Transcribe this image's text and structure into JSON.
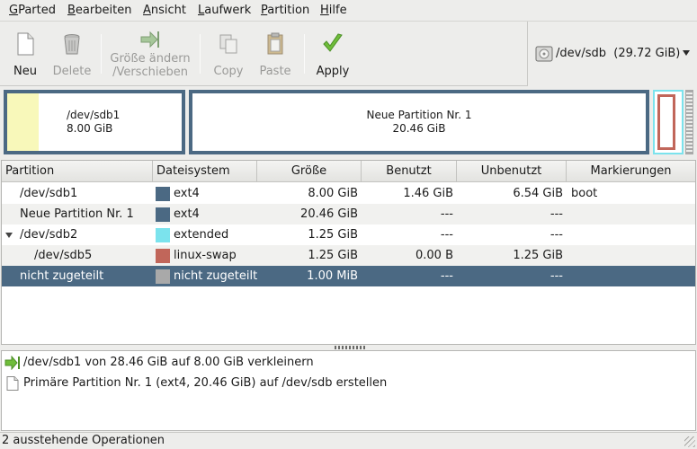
{
  "menubar": [
    {
      "pre": "",
      "key": "G",
      "post": "Parted"
    },
    {
      "pre": "",
      "key": "B",
      "post": "earbeiten"
    },
    {
      "pre": "",
      "key": "A",
      "post": "nsicht"
    },
    {
      "pre": "",
      "key": "L",
      "post": "aufwerk"
    },
    {
      "pre": "",
      "key": "P",
      "post": "artition"
    },
    {
      "pre": "",
      "key": "H",
      "post": "ilfe"
    }
  ],
  "toolbar": {
    "new": "Neu",
    "delete": "Delete",
    "resize_line1": "Größe ändern",
    "resize_line2": "/Verschieben",
    "copy": "Copy",
    "paste": "Paste",
    "apply": "Apply"
  },
  "device": {
    "name": "/dev/sdb",
    "size": "(29.72 GiB)",
    "icon": "harddisk-icon"
  },
  "graphic": {
    "sdb1_name": "/dev/sdb1",
    "sdb1_size": "8.00 GiB",
    "sdb1_used_fraction": 0.18,
    "new_name": "Neue Partition Nr. 1",
    "new_size": "20.46 GiB"
  },
  "table": {
    "headers": [
      "Partition",
      "Dateisystem",
      "Größe",
      "Benutzt",
      "Unbenutzt",
      "Markierungen"
    ],
    "rows": [
      {
        "partition": "/dev/sdb1",
        "fs": "ext4",
        "color": "#4b6983",
        "size": "8.00 GiB",
        "used": "1.46 GiB",
        "unused": "6.54 GiB",
        "flags": "boot"
      },
      {
        "partition": "Neue Partition Nr. 1",
        "fs": "ext4",
        "color": "#4b6983",
        "size": "20.46 GiB",
        "used": "---",
        "unused": "---",
        "flags": ""
      },
      {
        "partition": "/dev/sdb2",
        "fs": "extended",
        "color": "#7be3ed",
        "size": "1.25 GiB",
        "used": "---",
        "unused": "---",
        "flags": ""
      },
      {
        "partition": "/dev/sdb5",
        "fs": "linux-swap",
        "color": "#c1665a",
        "size": "1.25 GiB",
        "used": "0.00 B",
        "unused": "1.25 GiB",
        "flags": ""
      },
      {
        "partition": "nicht zugeteilt",
        "fs": "nicht zugeteilt",
        "color": "#a9a9a9",
        "size": "1.00 MiB",
        "used": "---",
        "unused": "---",
        "flags": ""
      }
    ]
  },
  "operations": [
    {
      "icon": "resize-arrow-icon",
      "text": "/dev/sdb1 von 28.46 GiB auf 8.00 GiB verkleinern"
    },
    {
      "icon": "new-document-icon",
      "text": "Primäre Partition Nr. 1 (ext4, 20.46 GiB) auf /dev/sdb erstellen"
    }
  ],
  "status": "2 ausstehende Operationen"
}
